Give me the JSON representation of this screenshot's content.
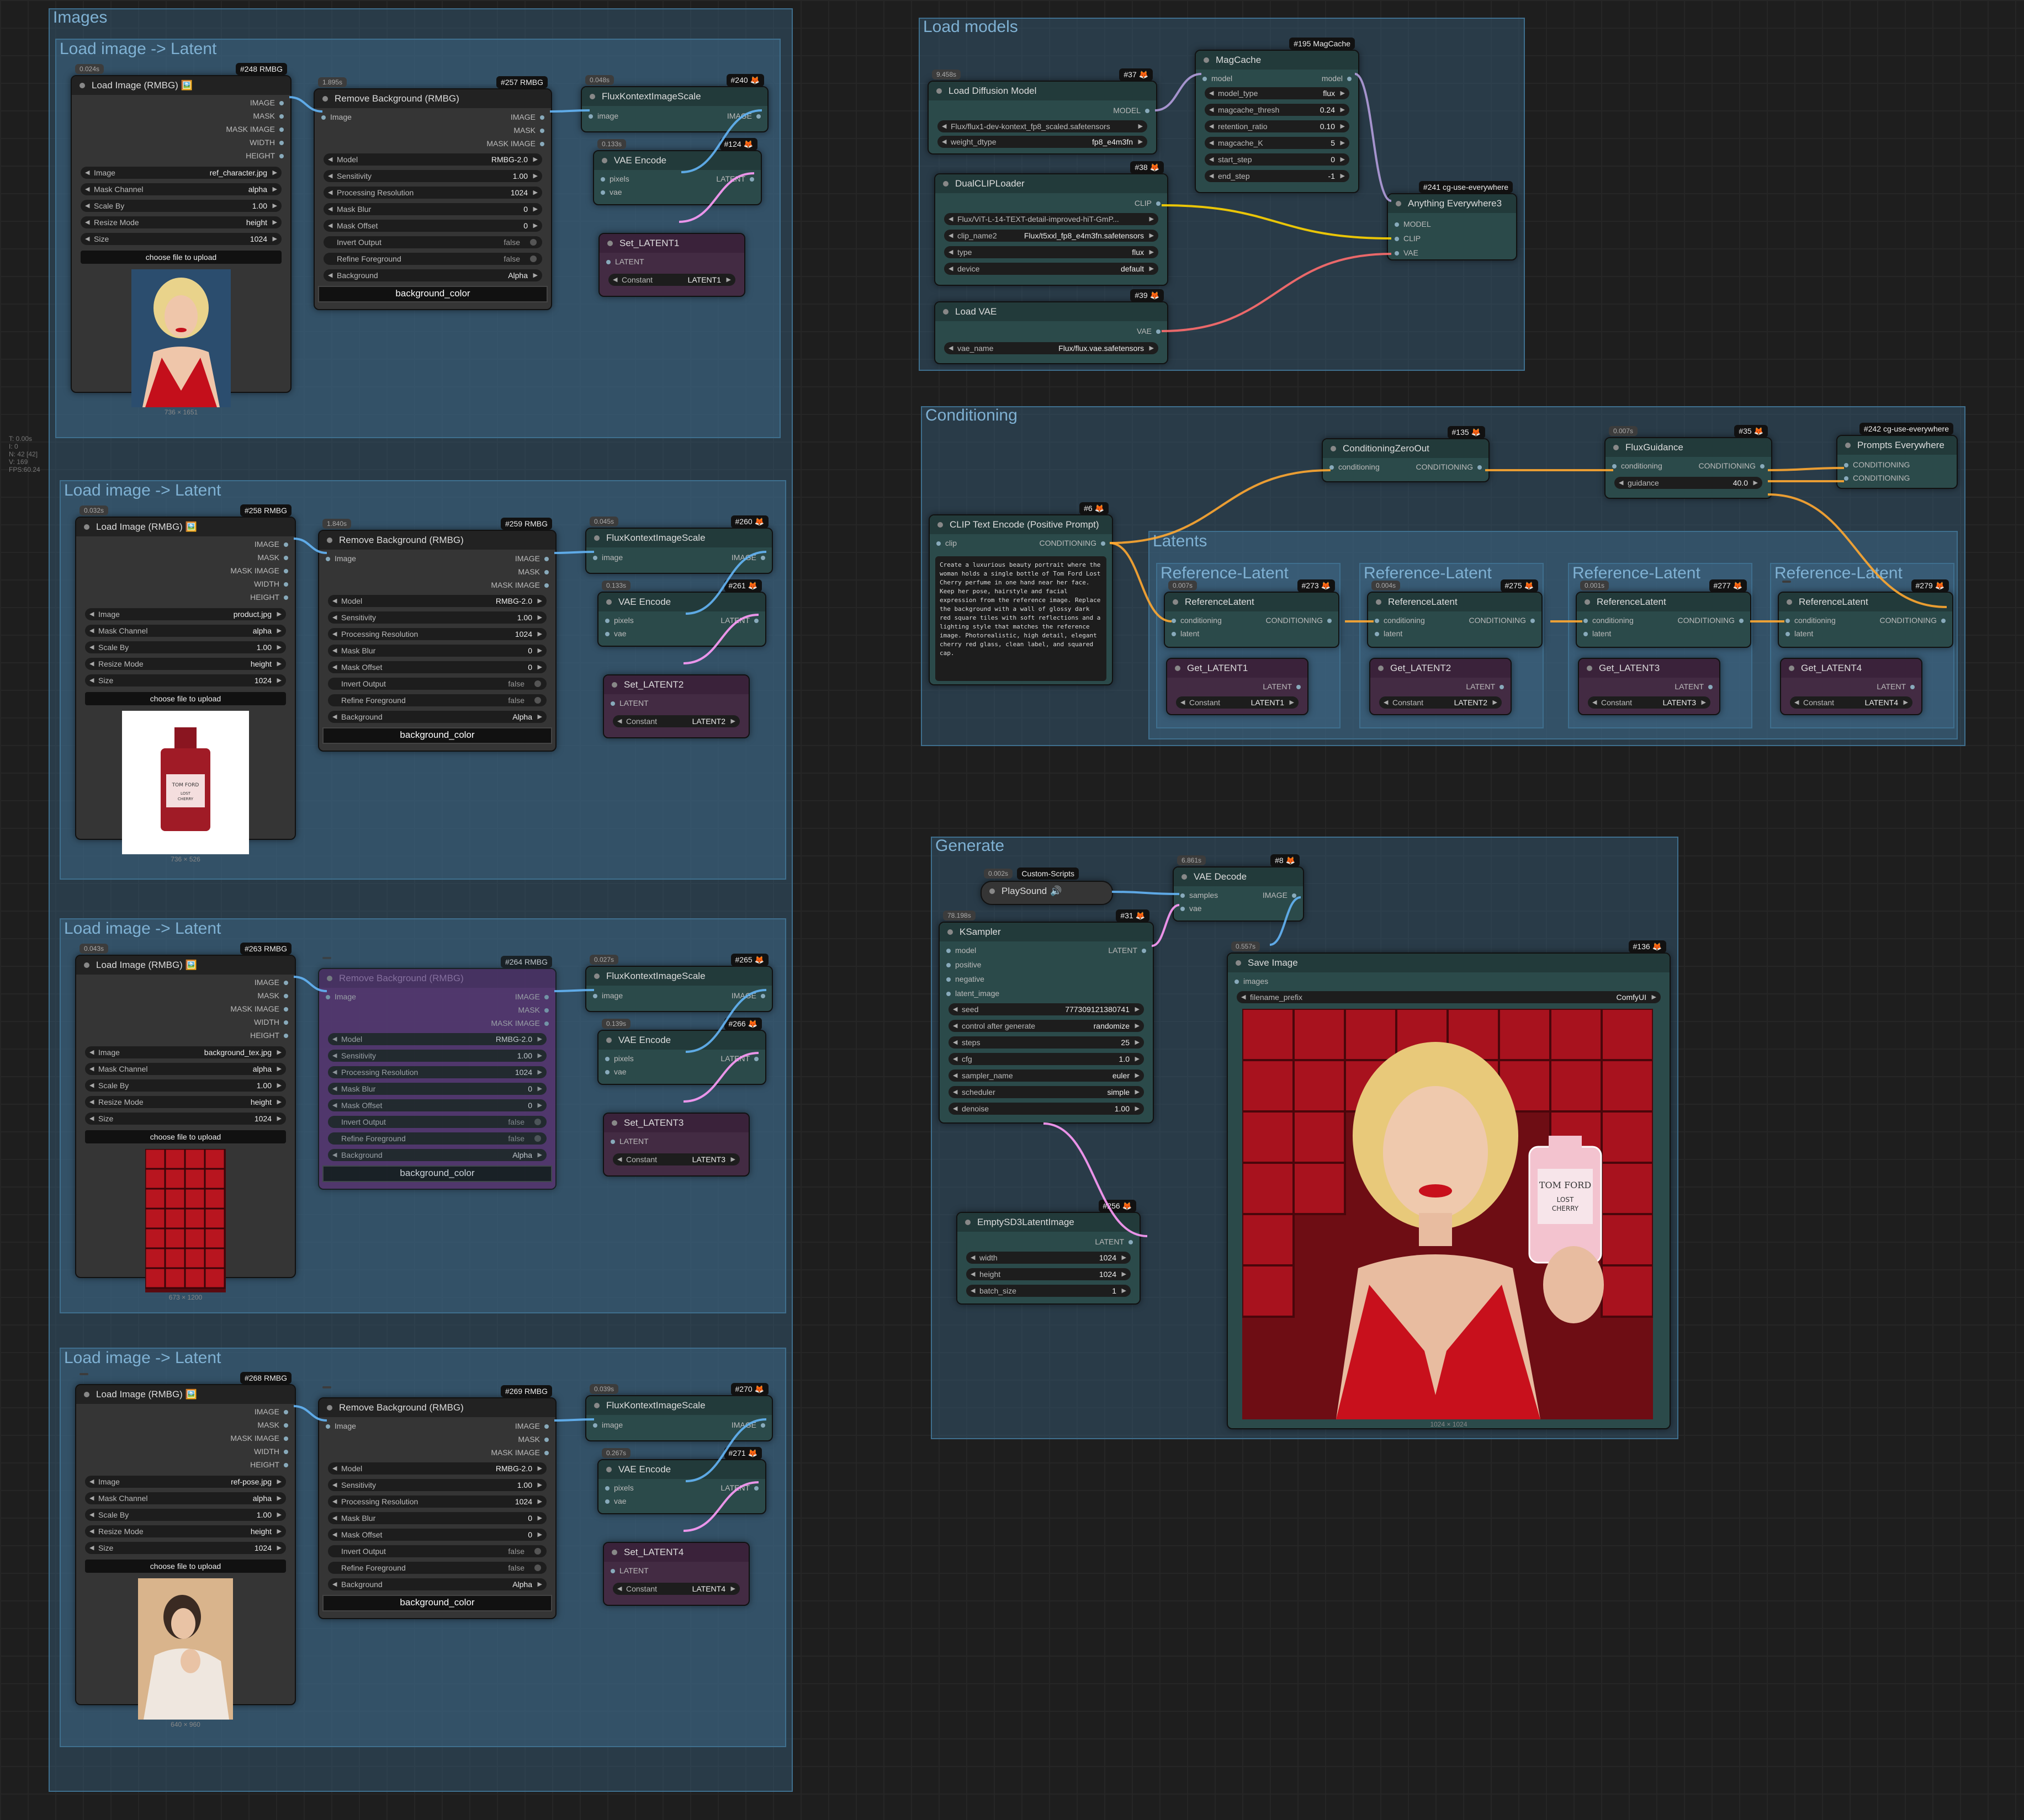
{
  "stats": {
    "t": "T: 0.00s",
    "i": "I: 0",
    "n": "N: 42 [42]",
    "v": "V: 169",
    "fps": "FPS:60.24"
  },
  "groups": {
    "images": "Images",
    "load1": "Load image -> Latent",
    "load2": "Load image -> Latent",
    "load3": "Load image -> Latent",
    "load4": "Load image -> Latent",
    "load_models": "Load models",
    "conditioning": "Conditioning",
    "latents": "Latents",
    "ref1": "Reference-Latent",
    "ref2": "Reference-Latent",
    "ref3": "Reference-Latent",
    "ref4": "Reference-Latent",
    "generate": "Generate"
  },
  "common": {
    "load_image_title": "Load Image (RMBG) 🖼️",
    "out_image": "IMAGE",
    "out_mask": "MASK",
    "out_mask_image": "MASK IMAGE",
    "out_width": "WIDTH",
    "out_height": "HEIGHT",
    "w_image": "Image",
    "w_mask_channel": "Mask Channel",
    "w_scale_by": "Scale By",
    "w_resize_mode": "Resize Mode",
    "w_size": "Size",
    "upload": "choose file to upload",
    "rmbg_title": "Remove Background (RMBG)",
    "in_image": "Image",
    "w_model": "Model",
    "w_sensitivity": "Sensitivity",
    "w_processing": "Processing Resolution",
    "w_mask_blur": "Mask Blur",
    "w_mask_offset": "Mask Offset",
    "w_invert": "Invert Output",
    "w_refine": "Refine Foreground",
    "w_background": "Background",
    "bg_color": "background_color",
    "scale_title": "FluxKontextImageScale",
    "in_image_l": "image",
    "out_image_u": "IMAGE",
    "vae_encode": "VAE Encode",
    "in_pixels": "pixels",
    "in_vae": "vae",
    "out_latent": "LATENT",
    "set_in": "LATENT",
    "set_constant": "Constant",
    "ref_title": "ReferenceLatent",
    "in_conditioning": "conditioning",
    "in_latent": "latent",
    "out_conditioning": "CONDITIONING",
    "get_out": "LATENT"
  },
  "rows": [
    {
      "load_badge": "#248 RMBG",
      "load_time": "0.024s",
      "image": "ref_character.jpg",
      "mask_channel": "alpha",
      "scale": "1.00",
      "resize": "height",
      "size": "1024",
      "dims": "736 × 1651",
      "rmbg_badge": "#257 RMBG",
      "rmbg_time": "1.895s",
      "model": "RMBG-2.0",
      "sensitivity": "1.00",
      "processing": "1024",
      "blur": "0",
      "offset": "0",
      "invert": "false",
      "refine": "false",
      "background": "Alpha",
      "scale_badge": "#240",
      "scale_time": "0.048s",
      "vae_badge": "#124",
      "vae_time": "0.133s",
      "set_title": "Set_LATENT1",
      "constant": "LATENT1"
    },
    {
      "load_badge": "#258 RMBG",
      "load_time": "0.032s",
      "image": "product.jpg",
      "mask_channel": "alpha",
      "scale": "1.00",
      "resize": "height",
      "size": "1024",
      "dims": "736 × 526",
      "rmbg_badge": "#259 RMBG",
      "rmbg_time": "1.840s",
      "model": "RMBG-2.0",
      "sensitivity": "1.00",
      "processing": "1024",
      "blur": "0",
      "offset": "0",
      "invert": "false",
      "refine": "false",
      "background": "Alpha",
      "scale_badge": "#260",
      "scale_time": "0.045s",
      "vae_badge": "#261",
      "vae_time": "0.133s",
      "set_title": "Set_LATENT2",
      "constant": "LATENT2"
    },
    {
      "load_badge": "#263 RMBG",
      "load_time": "0.043s",
      "image": "background_tex.jpg",
      "mask_channel": "alpha",
      "scale": "1.00",
      "resize": "height",
      "size": "1024",
      "dims": "673 × 1200",
      "rmbg_badge": "#264 RMBG",
      "rmbg_time": "",
      "model": "RMBG-2.0",
      "sensitivity": "1.00",
      "processing": "1024",
      "blur": "0",
      "offset": "0",
      "invert": "false",
      "refine": "false",
      "background": "Alpha",
      "scale_badge": "#265",
      "scale_time": "0.027s",
      "vae_badge": "#266",
      "vae_time": "0.139s",
      "set_title": "Set_LATENT3",
      "constant": "LATENT3"
    },
    {
      "load_badge": "#268 RMBG",
      "load_time": "",
      "image": "ref-pose.jpg",
      "mask_channel": "alpha",
      "scale": "1.00",
      "resize": "height",
      "size": "1024",
      "dims": "640 × 960",
      "rmbg_badge": "#269 RMBG",
      "rmbg_time": "",
      "model": "RMBG-2.0",
      "sensitivity": "1.00",
      "processing": "1024",
      "blur": "0",
      "offset": "0",
      "invert": "false",
      "refine": "false",
      "background": "Alpha",
      "scale_badge": "#270",
      "scale_time": "0.039s",
      "vae_badge": "#271",
      "vae_time": "0.267s",
      "set_title": "Set_LATENT4",
      "constant": "LATENT4"
    }
  ],
  "models": {
    "diffusion": {
      "title": "Load Diffusion Model",
      "badge": "#37",
      "time": "9.458s",
      "out": "MODEL",
      "unet": "Flux/flux1-dev-kontext_fp8_scaled.safetensors",
      "dtype_label": "weight_dtype",
      "dtype": "fp8_e4m3fn"
    },
    "clip": {
      "title": "DualCLIPLoader",
      "badge": "#38",
      "out": "CLIP",
      "name1": "Flux/ViT-L-14-TEXT-detail-improved-hiT-GmP...",
      "name2_label": "clip_name2",
      "name2": "Flux/t5xxl_fp8_e4m3fn.safetensors",
      "type_label": "type",
      "type": "flux",
      "device_label": "device",
      "device": "default"
    },
    "vae": {
      "title": "Load VAE",
      "badge": "#39",
      "out": "VAE",
      "name_label": "vae_name",
      "name": "Flux/flux.vae.safetensors"
    },
    "magcache": {
      "title": "MagCache",
      "badge": "#195 MagCache",
      "in": "model",
      "out": "model",
      "w": [
        {
          "l": "model_type",
          "v": "flux"
        },
        {
          "l": "magcache_thresh",
          "v": "0.24"
        },
        {
          "l": "retention_ratio",
          "v": "0.10"
        },
        {
          "l": "magcache_K",
          "v": "5"
        },
        {
          "l": "start_step",
          "v": "0"
        },
        {
          "l": "end_step",
          "v": "-1"
        }
      ]
    },
    "anything": {
      "title": "Anything Everywhere3",
      "badge": "#241 cg-use-everywhere",
      "in1": "MODEL",
      "in2": "CLIP",
      "in3": "VAE"
    }
  },
  "cond": {
    "clip_text": {
      "title": "CLIP Text Encode (Positive Prompt)",
      "badge": "#6",
      "in": "clip",
      "out": "CONDITIONING",
      "prompt": "Create a luxurious beauty portrait where the woman holds a single bottle of Tom Ford Lost Cherry perfume in one hand near her face. Keep her pose, hairstyle and facial expression from the reference image. Replace the background with a wall of glossy dark red square tiles with soft reflections and a lighting style that matches the reference image. Photorealistic, high detail, elegant cherry red glass, clean label, and squared cap."
    },
    "zero": {
      "title": "ConditioningZeroOut",
      "badge": "#135",
      "in": "conditioning",
      "out": "CONDITIONING"
    },
    "guidance": {
      "title": "FluxGuidance",
      "badge": "#35",
      "time": "0.007s",
      "in": "conditioning",
      "out": "CONDITIONING",
      "w_label": "guidance",
      "w_value": "40.0"
    },
    "prompts": {
      "title": "Prompts Everywhere",
      "badge": "#242 cg-use-everywhere",
      "in1": "CONDITIONING",
      "in2": "CONDITIONING"
    },
    "refs": [
      {
        "badge": "#273",
        "time": "0.007s",
        "get": "Get_LATENT1",
        "constant": "LATENT1"
      },
      {
        "badge": "#275",
        "time": "0.004s",
        "get": "Get_LATENT2",
        "constant": "LATENT2"
      },
      {
        "badge": "#277",
        "time": "0.001s",
        "get": "Get_LATENT3",
        "constant": "LATENT3"
      },
      {
        "badge": "#279",
        "time": "",
        "get": "Get_LATENT4",
        "constant": "LATENT4"
      }
    ]
  },
  "gen": {
    "playsound": {
      "title": "PlaySound",
      "tag": "Custom-Scripts",
      "time": "0.002s"
    },
    "vae_decode": {
      "title": "VAE Decode",
      "badge": "#8",
      "time": "6.861s",
      "in1": "samples",
      "in2": "vae",
      "out": "IMAGE"
    },
    "ksampler": {
      "title": "KSampler",
      "badge": "#31",
      "time": "78.198s",
      "out": "LATENT",
      "inputs": [
        "model",
        "positive",
        "negative",
        "latent_image"
      ],
      "w": [
        {
          "l": "seed",
          "v": "777309121380741"
        },
        {
          "l": "control after generate",
          "v": "randomize"
        },
        {
          "l": "steps",
          "v": "25"
        },
        {
          "l": "cfg",
          "v": "1.0"
        },
        {
          "l": "sampler_name",
          "v": "euler"
        },
        {
          "l": "scheduler",
          "v": "simple"
        },
        {
          "l": "denoise",
          "v": "1.00"
        }
      ]
    },
    "empty": {
      "title": "EmptySD3LatentImage",
      "badge": "#256",
      "out": "LATENT",
      "w": [
        {
          "l": "width",
          "v": "1024"
        },
        {
          "l": "height",
          "v": "1024"
        },
        {
          "l": "batch_size",
          "v": "1"
        }
      ]
    },
    "save": {
      "title": "Save Image",
      "badge": "#136",
      "time": "0.557s",
      "in": "images",
      "w_label": "filename_prefix",
      "w_value": "ComfyUI",
      "dims": "1024 × 1024"
    }
  },
  "colors": {
    "link_image": "#64b5f6",
    "link_latent": "#ff9cf9",
    "link_clip": "#ffd500",
    "link_vae": "#ff6e6e",
    "link_model": "#b39ddb",
    "link_cond": "#ffa931"
  }
}
